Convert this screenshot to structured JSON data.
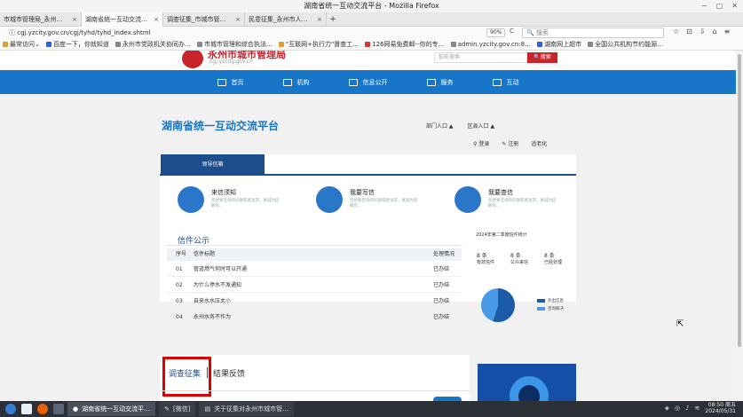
{
  "window": {
    "title": "湖南省统一互动交流平台 - Mozilla Firefox",
    "controls": [
      "−",
      "▢",
      "✕"
    ]
  },
  "tabs": [
    {
      "label": "市城市管理局_永州…",
      "close": "×"
    },
    {
      "label": "湖南省统一互动交流…",
      "close": "×"
    },
    {
      "label": "调查征集_市城市管…",
      "close": "×"
    },
    {
      "label": "民意征集_永州市人…",
      "close": "×"
    }
  ],
  "new_tab": "+",
  "nav": {
    "url": "ⓘ cgj.yzcity.gov.cn/cgj/tyhd/tyhd_index.shtml",
    "zoom": "90%",
    "reload": "C",
    "search_placeholder": "🔍 搜索",
    "icons": [
      "☆",
      "⊡",
      "⇩",
      "⌂",
      "≡"
    ]
  },
  "bookmarks": [
    {
      "label": "最常访问⌄",
      "color": "#e0a030"
    },
    {
      "label": "百度一下，你就知道",
      "color": "#2a63d8"
    },
    {
      "label": "永州市党政机关协同办…",
      "color": "#888"
    },
    {
      "label": "市城市管理和综合执法…",
      "color": "#888"
    },
    {
      "label": "\"互联网+执行力\"督查工…",
      "color": "#e0a030"
    },
    {
      "label": "126网易免费邮--你的专…",
      "color": "#d33"
    },
    {
      "label": "admin.yzcity.gov.cn:8…",
      "color": "#888"
    },
    {
      "label": "湖南网上超市",
      "color": "#2a63d8"
    },
    {
      "label": "全国公共机构节约能源…",
      "color": "#888"
    }
  ],
  "site": {
    "logo_title": "永州市城市管理局",
    "logo_url": "cgj.yzcity.gov.cn",
    "search_placeholder": "智能搜索",
    "search_button": "搜索"
  },
  "menu": [
    "首页",
    "机构",
    "信息公开",
    "服务",
    "互动"
  ],
  "panel": {
    "title": "湖南省统一互动交流平台",
    "dept_entry": "部门入口 ▲",
    "county_entry": "区县入口 ▲",
    "login": "登录",
    "register": "注册",
    "elderly": "适老化",
    "tab_leader": "领导信箱"
  },
  "services": [
    {
      "title": "来信须知",
      "desc": "您想要咨询的问题或者诉求，真诚为您解答。"
    },
    {
      "title": "我要写信",
      "desc": "您想要咨询的问题或者诉求，真诚为您解答。"
    },
    {
      "title": "我要查信",
      "desc": "您想要咨询的问题或者诉求，真诚为您解答。"
    }
  ],
  "notice": {
    "title": "信件公示",
    "headers": {
      "no": "序号",
      "title": "信件标题",
      "status": "处理情况"
    },
    "rows": [
      {
        "no": "01",
        "title": "管道燃气何时可以开通",
        "status": "已办结"
      },
      {
        "no": "02",
        "title": "为什么停水不发通知",
        "status": "已办结"
      },
      {
        "no": "03",
        "title": "自来水水压太小",
        "status": "已办结"
      },
      {
        "no": "04",
        "title": "永州水务不作为",
        "status": "已办结"
      }
    ]
  },
  "stats": {
    "title": "2024年第二季度信件统计",
    "items": [
      {
        "value": "8 条",
        "label": "有效信件"
      },
      {
        "value": "8 条",
        "label": "公众来信"
      },
      {
        "value": "8 条",
        "label": "已经处理"
      }
    ],
    "legend": [
      {
        "label": "外出信息",
        "color": "#1c5ba8"
      },
      {
        "label": "咨询解决",
        "color": "#4a9ae8"
      }
    ],
    "pie": [
      {
        "value": 0.55,
        "color": "#1c5ba8"
      },
      {
        "value": 0.45,
        "color": "#4a9ae8"
      }
    ]
  },
  "lower": {
    "survey": "调查征集",
    "feedback": "结果反馈"
  },
  "taskbar": {
    "tasks": [
      {
        "label": "湖南省统一互动交流平…",
        "active": true
      },
      {
        "label": "[微信]",
        "active": false
      },
      {
        "label": "关于征集对永州市城市管…",
        "active": false
      }
    ],
    "time": "08:50 周五",
    "date": "2024/05/31"
  }
}
